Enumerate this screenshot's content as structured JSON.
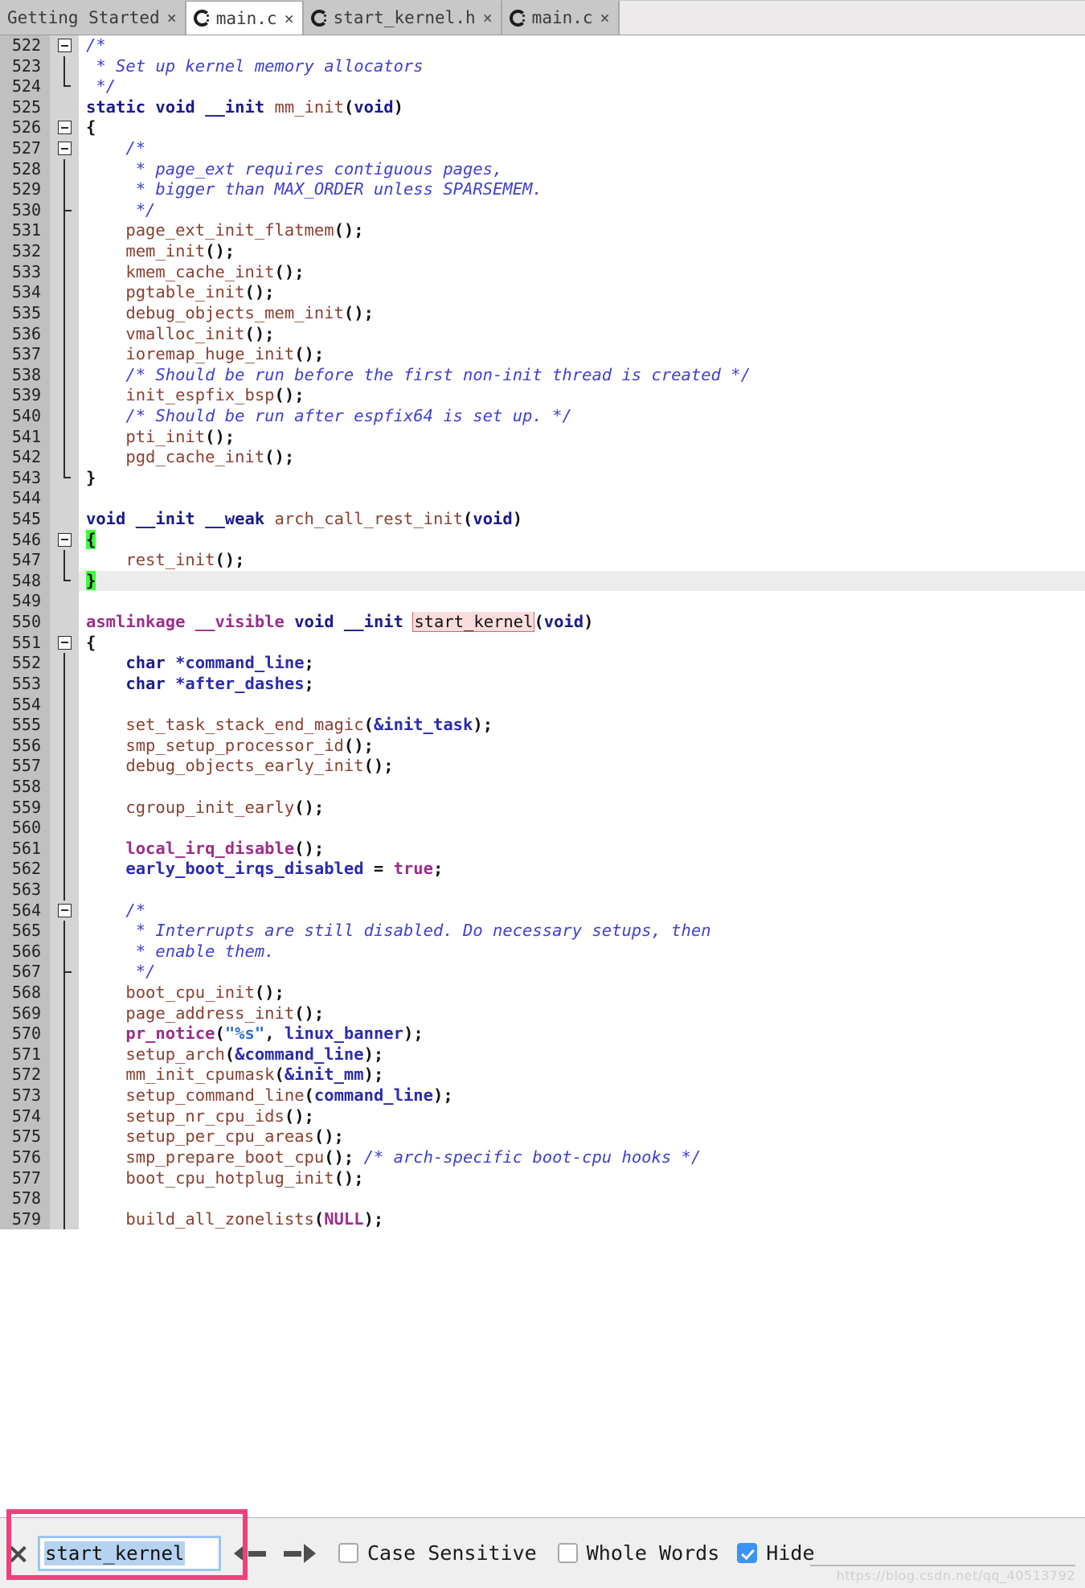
{
  "window": {
    "app": "Eclipse CDT Editor",
    "accent_focus": "#9cc4f0",
    "annotation_color": "#f0407a",
    "brace_match_color": "#3cff3c",
    "occurrence_color": "#fbdcdc"
  },
  "tabs": [
    {
      "label": "Getting Started",
      "icon": "none",
      "close": "×",
      "active": false
    },
    {
      "label": "main.c",
      "icon": "c-file-icon",
      "close": "×",
      "active": true
    },
    {
      "label": "start_kernel.h",
      "icon": "c-file-icon",
      "close": "×",
      "active": false
    },
    {
      "label": "main.c",
      "icon": "c-file-icon",
      "close": "×",
      "active": false
    }
  ],
  "editor": {
    "first_line": 522,
    "current_line": 548,
    "lines": [
      {
        "n": "522",
        "fold": "box-start",
        "tokens": [
          {
            "t": "/*",
            "c": "cmt"
          }
        ]
      },
      {
        "n": "523",
        "fold": "vline",
        "tokens": [
          {
            "t": " * Set up kernel memory allocators",
            "c": "cmt"
          }
        ]
      },
      {
        "n": "524",
        "fold": "elbow",
        "tokens": [
          {
            "t": " */",
            "c": "cmt"
          }
        ]
      },
      {
        "n": "525",
        "fold": "none",
        "tokens": [
          {
            "t": "static",
            "c": "kw"
          },
          {
            "t": " ",
            "c": "plain"
          },
          {
            "t": "void",
            "c": "kw"
          },
          {
            "t": " ",
            "c": "plain"
          },
          {
            "t": "__init",
            "c": "kw"
          },
          {
            "t": " ",
            "c": "plain"
          },
          {
            "t": "mm_init",
            "c": "fn"
          },
          {
            "t": "(",
            "c": "paren"
          },
          {
            "t": "void",
            "c": "kw"
          },
          {
            "t": ")",
            "c": "paren"
          }
        ]
      },
      {
        "n": "526",
        "fold": "box-start",
        "tokens": [
          {
            "t": "{",
            "c": "brace"
          }
        ]
      },
      {
        "n": "527",
        "fold": "box-nested",
        "tokens": [
          {
            "t": "    /*",
            "c": "cmt"
          }
        ]
      },
      {
        "n": "528",
        "fold": "vline",
        "tokens": [
          {
            "t": "     * page_ext requires contiguous pages,",
            "c": "cmt"
          }
        ]
      },
      {
        "n": "529",
        "fold": "vline",
        "tokens": [
          {
            "t": "     * bigger than MAX_ORDER unless SPARSEMEM.",
            "c": "cmt"
          }
        ]
      },
      {
        "n": "530",
        "fold": "tick",
        "tokens": [
          {
            "t": "     */",
            "c": "cmt"
          }
        ]
      },
      {
        "n": "531",
        "fold": "vline",
        "tokens": [
          {
            "t": "    ",
            "c": "plain"
          },
          {
            "t": "page_ext_init_flatmem",
            "c": "fn"
          },
          {
            "t": "();",
            "c": "paren"
          }
        ]
      },
      {
        "n": "532",
        "fold": "vline",
        "tokens": [
          {
            "t": "    ",
            "c": "plain"
          },
          {
            "t": "mem_init",
            "c": "fn"
          },
          {
            "t": "();",
            "c": "paren"
          }
        ]
      },
      {
        "n": "533",
        "fold": "vline",
        "tokens": [
          {
            "t": "    ",
            "c": "plain"
          },
          {
            "t": "kmem_cache_init",
            "c": "fn"
          },
          {
            "t": "();",
            "c": "paren"
          }
        ]
      },
      {
        "n": "534",
        "fold": "vline",
        "tokens": [
          {
            "t": "    ",
            "c": "plain"
          },
          {
            "t": "pgtable_init",
            "c": "fn"
          },
          {
            "t": "();",
            "c": "paren"
          }
        ]
      },
      {
        "n": "535",
        "fold": "vline",
        "tokens": [
          {
            "t": "    ",
            "c": "plain"
          },
          {
            "t": "debug_objects_mem_init",
            "c": "fn"
          },
          {
            "t": "();",
            "c": "paren"
          }
        ]
      },
      {
        "n": "536",
        "fold": "vline",
        "tokens": [
          {
            "t": "    ",
            "c": "plain"
          },
          {
            "t": "vmalloc_init",
            "c": "fn"
          },
          {
            "t": "();",
            "c": "paren"
          }
        ]
      },
      {
        "n": "537",
        "fold": "vline",
        "tokens": [
          {
            "t": "    ",
            "c": "plain"
          },
          {
            "t": "ioremap_huge_init",
            "c": "fn"
          },
          {
            "t": "();",
            "c": "paren"
          }
        ]
      },
      {
        "n": "538",
        "fold": "vline",
        "tokens": [
          {
            "t": "    /* Should be run before the first non-init thread is created */",
            "c": "cmt"
          }
        ]
      },
      {
        "n": "539",
        "fold": "vline",
        "tokens": [
          {
            "t": "    ",
            "c": "plain"
          },
          {
            "t": "init_espfix_bsp",
            "c": "fn"
          },
          {
            "t": "();",
            "c": "paren"
          }
        ]
      },
      {
        "n": "540",
        "fold": "vline",
        "tokens": [
          {
            "t": "    /* Should be run after espfix64 is set up. */",
            "c": "cmt"
          }
        ]
      },
      {
        "n": "541",
        "fold": "vline",
        "tokens": [
          {
            "t": "    ",
            "c": "plain"
          },
          {
            "t": "pti_init",
            "c": "fn"
          },
          {
            "t": "();",
            "c": "paren"
          }
        ]
      },
      {
        "n": "542",
        "fold": "vline",
        "tokens": [
          {
            "t": "    ",
            "c": "plain"
          },
          {
            "t": "pgd_cache_init",
            "c": "fn"
          },
          {
            "t": "();",
            "c": "paren"
          }
        ]
      },
      {
        "n": "543",
        "fold": "elbow",
        "tokens": [
          {
            "t": "}",
            "c": "brace"
          }
        ]
      },
      {
        "n": "544",
        "fold": "none",
        "tokens": []
      },
      {
        "n": "545",
        "fold": "none",
        "tokens": [
          {
            "t": "void",
            "c": "kw"
          },
          {
            "t": " ",
            "c": "plain"
          },
          {
            "t": "__init",
            "c": "kw"
          },
          {
            "t": " ",
            "c": "plain"
          },
          {
            "t": "__weak",
            "c": "kw"
          },
          {
            "t": " ",
            "c": "plain"
          },
          {
            "t": "arch_call_rest_init",
            "c": "fn"
          },
          {
            "t": "(",
            "c": "paren"
          },
          {
            "t": "void",
            "c": "kw"
          },
          {
            "t": ")",
            "c": "paren"
          }
        ]
      },
      {
        "n": "546",
        "fold": "box-start",
        "tokens": [
          {
            "t": "{",
            "c": "brace-hl"
          }
        ]
      },
      {
        "n": "547",
        "fold": "vline",
        "tokens": [
          {
            "t": "    ",
            "c": "plain"
          },
          {
            "t": "rest_init",
            "c": "fn"
          },
          {
            "t": "();",
            "c": "paren"
          }
        ]
      },
      {
        "n": "548",
        "fold": "elbow",
        "tokens": [
          {
            "t": "}",
            "c": "brace-hl"
          }
        ]
      },
      {
        "n": "549",
        "fold": "none",
        "tokens": []
      },
      {
        "n": "550",
        "fold": "none",
        "tokens": [
          {
            "t": "asmlinkage",
            "c": "macro"
          },
          {
            "t": " ",
            "c": "plain"
          },
          {
            "t": "__visible",
            "c": "macro"
          },
          {
            "t": " ",
            "c": "plain"
          },
          {
            "t": "void",
            "c": "kw"
          },
          {
            "t": " ",
            "c": "plain"
          },
          {
            "t": "__init",
            "c": "kw"
          },
          {
            "t": " ",
            "c": "plain"
          },
          {
            "t": "start_kernel",
            "c": "occ"
          },
          {
            "t": "(",
            "c": "paren"
          },
          {
            "t": "void",
            "c": "kw"
          },
          {
            "t": ")",
            "c": "paren"
          }
        ]
      },
      {
        "n": "551",
        "fold": "box-start",
        "tokens": [
          {
            "t": "{",
            "c": "brace"
          }
        ]
      },
      {
        "n": "552",
        "fold": "vline",
        "tokens": [
          {
            "t": "    ",
            "c": "plain"
          },
          {
            "t": "char",
            "c": "kw"
          },
          {
            "t": " ",
            "c": "plain"
          },
          {
            "t": "*command_line",
            "c": "var"
          },
          {
            "t": ";",
            "c": "paren"
          }
        ]
      },
      {
        "n": "553",
        "fold": "vline",
        "tokens": [
          {
            "t": "    ",
            "c": "plain"
          },
          {
            "t": "char",
            "c": "kw"
          },
          {
            "t": " ",
            "c": "plain"
          },
          {
            "t": "*after_dashes",
            "c": "var"
          },
          {
            "t": ";",
            "c": "paren"
          }
        ]
      },
      {
        "n": "554",
        "fold": "vline",
        "tokens": []
      },
      {
        "n": "555",
        "fold": "vline",
        "tokens": [
          {
            "t": "    ",
            "c": "plain"
          },
          {
            "t": "set_task_stack_end_magic",
            "c": "fn"
          },
          {
            "t": "(",
            "c": "paren"
          },
          {
            "t": "&init_task",
            "c": "var"
          },
          {
            "t": ");",
            "c": "paren"
          }
        ]
      },
      {
        "n": "556",
        "fold": "vline",
        "tokens": [
          {
            "t": "    ",
            "c": "plain"
          },
          {
            "t": "smp_setup_processor_id",
            "c": "fn"
          },
          {
            "t": "();",
            "c": "paren"
          }
        ]
      },
      {
        "n": "557",
        "fold": "vline",
        "tokens": [
          {
            "t": "    ",
            "c": "plain"
          },
          {
            "t": "debug_objects_early_init",
            "c": "fn"
          },
          {
            "t": "();",
            "c": "paren"
          }
        ]
      },
      {
        "n": "558",
        "fold": "vline",
        "tokens": []
      },
      {
        "n": "559",
        "fold": "vline",
        "tokens": [
          {
            "t": "    ",
            "c": "plain"
          },
          {
            "t": "cgroup_init_early",
            "c": "fn"
          },
          {
            "t": "();",
            "c": "paren"
          }
        ]
      },
      {
        "n": "560",
        "fold": "vline",
        "tokens": []
      },
      {
        "n": "561",
        "fold": "vline",
        "tokens": [
          {
            "t": "    ",
            "c": "plain"
          },
          {
            "t": "local_irq_disable",
            "c": "macro"
          },
          {
            "t": "();",
            "c": "paren"
          }
        ]
      },
      {
        "n": "562",
        "fold": "vline",
        "tokens": [
          {
            "t": "    ",
            "c": "plain"
          },
          {
            "t": "early_boot_irqs_disabled",
            "c": "var"
          },
          {
            "t": " = ",
            "c": "plain"
          },
          {
            "t": "true",
            "c": "macro"
          },
          {
            "t": ";",
            "c": "paren"
          }
        ]
      },
      {
        "n": "563",
        "fold": "vline",
        "tokens": []
      },
      {
        "n": "564",
        "fold": "box-nested",
        "tokens": [
          {
            "t": "    /*",
            "c": "cmt"
          }
        ]
      },
      {
        "n": "565",
        "fold": "vline",
        "tokens": [
          {
            "t": "     * Interrupts are still disabled. Do necessary setups, then",
            "c": "cmt"
          }
        ]
      },
      {
        "n": "566",
        "fold": "vline",
        "tokens": [
          {
            "t": "     * enable them.",
            "c": "cmt"
          }
        ]
      },
      {
        "n": "567",
        "fold": "tick",
        "tokens": [
          {
            "t": "     */",
            "c": "cmt"
          }
        ]
      },
      {
        "n": "568",
        "fold": "vline",
        "tokens": [
          {
            "t": "    ",
            "c": "plain"
          },
          {
            "t": "boot_cpu_init",
            "c": "fn"
          },
          {
            "t": "();",
            "c": "paren"
          }
        ]
      },
      {
        "n": "569",
        "fold": "vline",
        "tokens": [
          {
            "t": "    ",
            "c": "plain"
          },
          {
            "t": "page_address_init",
            "c": "fn"
          },
          {
            "t": "();",
            "c": "paren"
          }
        ]
      },
      {
        "n": "570",
        "fold": "vline",
        "tokens": [
          {
            "t": "    ",
            "c": "plain"
          },
          {
            "t": "pr_notice",
            "c": "macro"
          },
          {
            "t": "(",
            "c": "paren"
          },
          {
            "t": "\"%s\"",
            "c": "str"
          },
          {
            "t": ", ",
            "c": "plain"
          },
          {
            "t": "linux_banner",
            "c": "var"
          },
          {
            "t": ");",
            "c": "paren"
          }
        ]
      },
      {
        "n": "571",
        "fold": "vline",
        "tokens": [
          {
            "t": "    ",
            "c": "plain"
          },
          {
            "t": "setup_arch",
            "c": "fn"
          },
          {
            "t": "(",
            "c": "paren"
          },
          {
            "t": "&command_line",
            "c": "var"
          },
          {
            "t": ");",
            "c": "paren"
          }
        ]
      },
      {
        "n": "572",
        "fold": "vline",
        "tokens": [
          {
            "t": "    ",
            "c": "plain"
          },
          {
            "t": "mm_init_cpumask",
            "c": "fn"
          },
          {
            "t": "(",
            "c": "paren"
          },
          {
            "t": "&init_mm",
            "c": "var"
          },
          {
            "t": ");",
            "c": "paren"
          }
        ]
      },
      {
        "n": "573",
        "fold": "vline",
        "tokens": [
          {
            "t": "    ",
            "c": "plain"
          },
          {
            "t": "setup_command_line",
            "c": "fn"
          },
          {
            "t": "(",
            "c": "paren"
          },
          {
            "t": "command_line",
            "c": "var"
          },
          {
            "t": ");",
            "c": "paren"
          }
        ]
      },
      {
        "n": "574",
        "fold": "vline",
        "tokens": [
          {
            "t": "    ",
            "c": "plain"
          },
          {
            "t": "setup_nr_cpu_ids",
            "c": "fn"
          },
          {
            "t": "();",
            "c": "paren"
          }
        ]
      },
      {
        "n": "575",
        "fold": "vline",
        "tokens": [
          {
            "t": "    ",
            "c": "plain"
          },
          {
            "t": "setup_per_cpu_areas",
            "c": "fn"
          },
          {
            "t": "();",
            "c": "paren"
          }
        ]
      },
      {
        "n": "576",
        "fold": "vline",
        "tokens": [
          {
            "t": "    ",
            "c": "plain"
          },
          {
            "t": "smp_prepare_boot_cpu",
            "c": "fn"
          },
          {
            "t": "(); ",
            "c": "paren"
          },
          {
            "t": "/* arch-specific boot-cpu hooks */",
            "c": "cmt"
          }
        ]
      },
      {
        "n": "577",
        "fold": "vline",
        "tokens": [
          {
            "t": "    ",
            "c": "plain"
          },
          {
            "t": "boot_cpu_hotplug_init",
            "c": "fn"
          },
          {
            "t": "();",
            "c": "paren"
          }
        ]
      },
      {
        "n": "578",
        "fold": "vline",
        "tokens": []
      },
      {
        "n": "579",
        "fold": "vline",
        "tokens": [
          {
            "t": "    ",
            "c": "plain"
          },
          {
            "t": "build_all_zonelists",
            "c": "fn"
          },
          {
            "t": "(",
            "c": "paren"
          },
          {
            "t": "NULL",
            "c": "macro"
          },
          {
            "t": ");",
            "c": "paren"
          }
        ]
      }
    ]
  },
  "findbar": {
    "close_label": "✕",
    "search_value": "start_kernel",
    "search_placeholder": "",
    "prev_label": "Find Previous",
    "next_label": "Find Next",
    "options": [
      {
        "label": "Case Sensitive",
        "checked": false
      },
      {
        "label": "Whole Words",
        "checked": false
      },
      {
        "label": "Hide",
        "checked": true
      }
    ]
  },
  "watermark": {
    "text": "https://blog.csdn.net/qq_40513792"
  }
}
